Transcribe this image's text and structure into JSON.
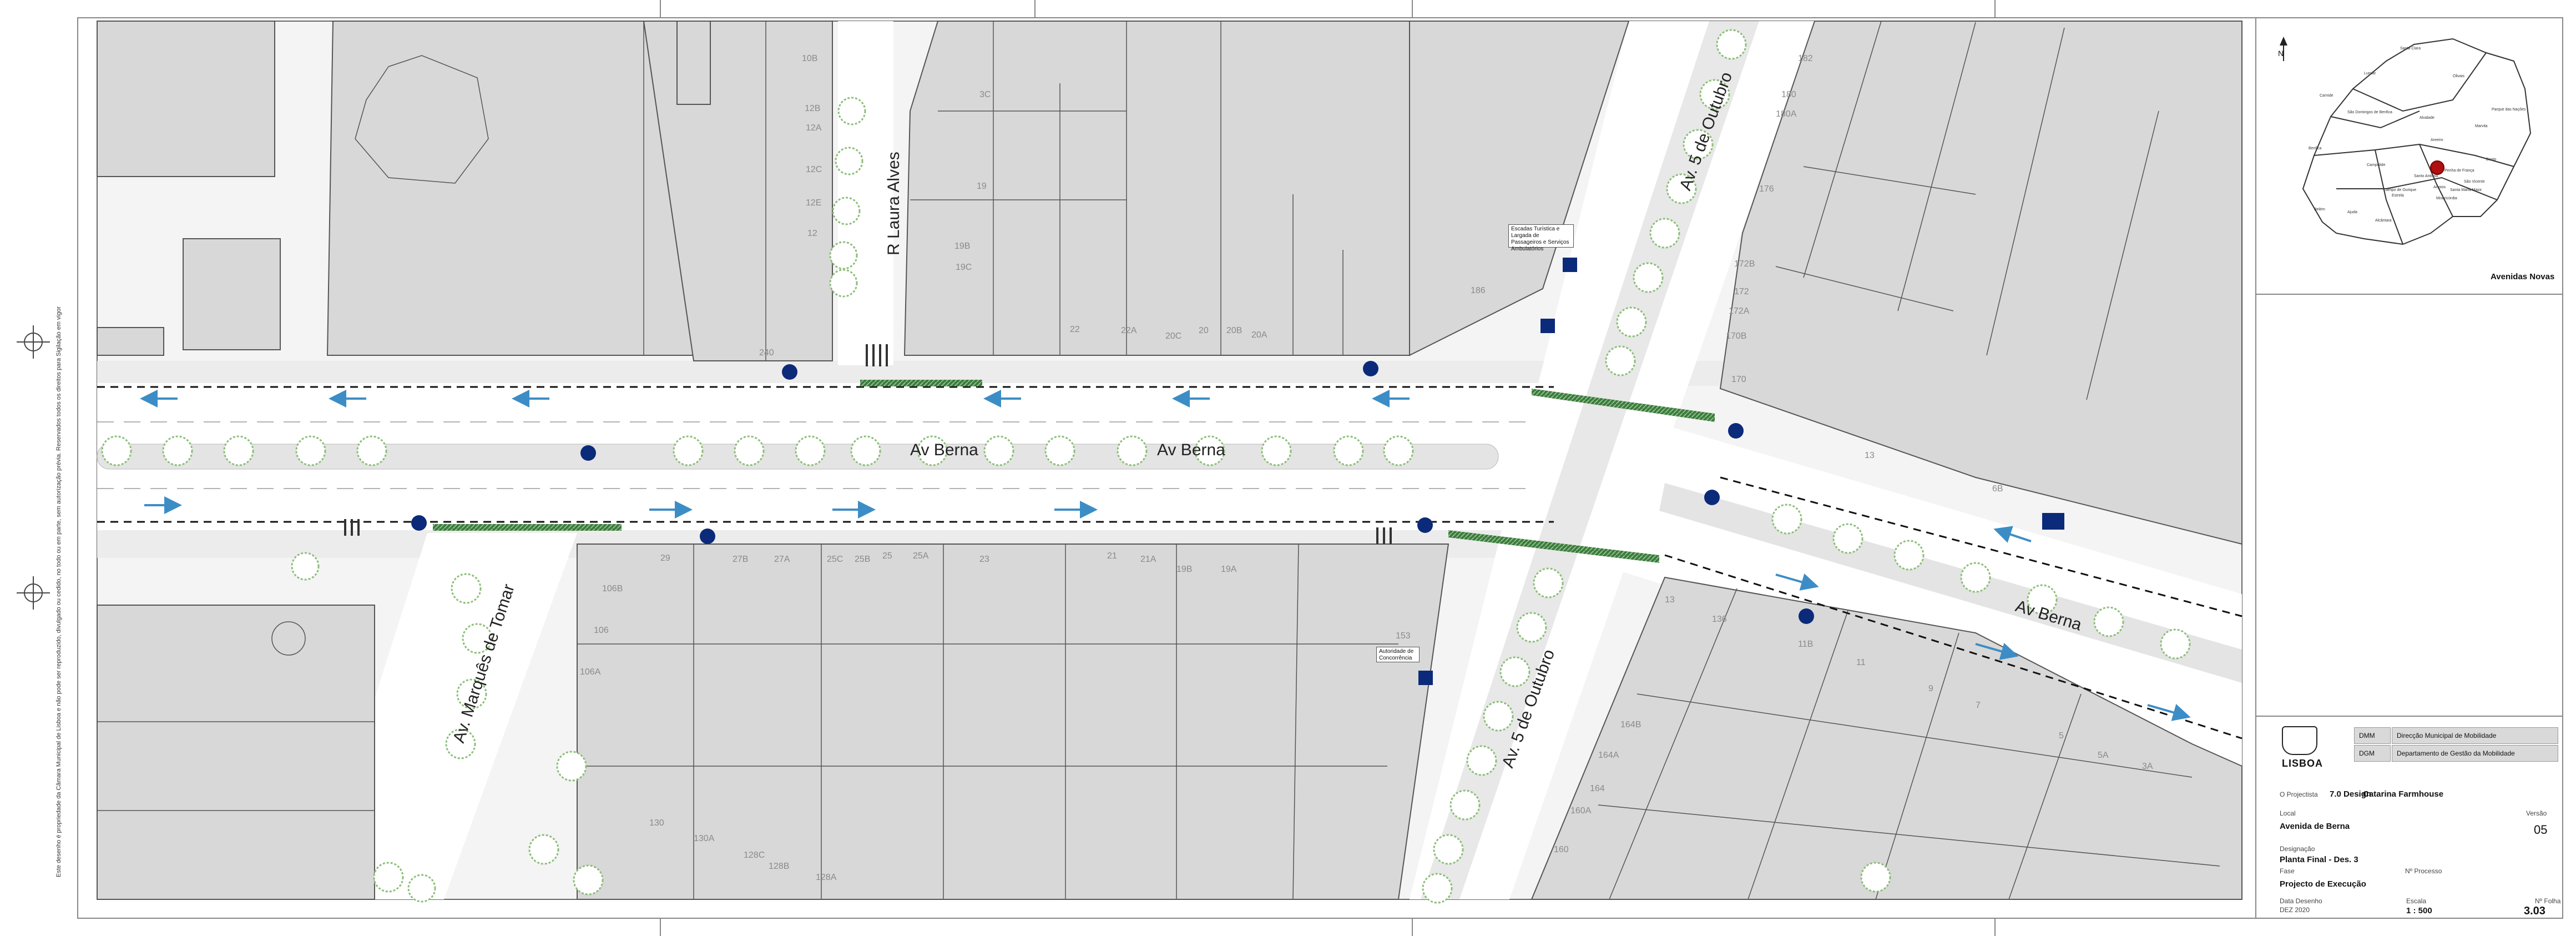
{
  "sheet": {
    "vertical_note": "Este desenho é propriedade da Câmara Municipal de Lisboa e não pode ser reproduzido, divulgado ou cedido, no todo ou em parte, sem autorização prévia. Reservados todos os direitos para Sigilação em vigor"
  },
  "streets": {
    "av_berna_west": "Av Berna",
    "av_berna_center": "Av Berna",
    "av_berna_east": "Av Berna",
    "r_laura_alves": "R Laura Alves",
    "av_5_outubro_north": "Av. 5 de Outubro",
    "av_5_outubro_south": "Av. 5 de Outubro",
    "av_marques_tomar": "Av. Marquês de Tomar"
  },
  "building_numbers": {
    "n1": "10B",
    "n2": "12B",
    "n3": "12A",
    "n4": "12C",
    "n5": "12E",
    "n6": "12",
    "n7": "3C",
    "n8": "19",
    "n9": "19B",
    "n10": "19C",
    "n11": "22",
    "n12": "22A",
    "n13": "20C",
    "n14": "20",
    "n15": "20B",
    "n16": "20A",
    "n17": "182",
    "n18": "180",
    "n19": "180A",
    "n20": "176",
    "n21": "172B",
    "n22": "172",
    "n23": "172A",
    "n24": "170B",
    "n25": "170",
    "n26": "29",
    "n27": "27B",
    "n28": "27A",
    "n29": "25C",
    "n30": "25B",
    "n31": "25",
    "n32": "25A",
    "n33": "23",
    "n34": "21",
    "n35": "21A",
    "n36": "19B",
    "n37": "19A",
    "n38": "106B",
    "n39": "106",
    "n40": "106A",
    "n41": "130",
    "n42": "130A",
    "n43": "128C",
    "n44": "128B",
    "n45": "128A",
    "n46": "136",
    "n47": "13",
    "n48": "11",
    "n49": "11B",
    "n50": "9",
    "n51": "7",
    "n52": "5",
    "n53": "5A",
    "n54": "3A",
    "n55": "164B",
    "n56": "164A",
    "n57": "164",
    "n58": "160",
    "n59": "160A",
    "n60": "240",
    "n61": "186",
    "n62": "6B",
    "n63": "13",
    "n64": "153"
  },
  "annotations": {
    "note_north": "Escadas Turística e Largada de Passageiros e Serviços Ambulatórios",
    "note_south": "Autoridade de Concorrência"
  },
  "locator": {
    "north_label": "N",
    "area_name": "Avenidas Novas",
    "parishes": [
      "Santa Clara",
      "Lumiar",
      "Olivais",
      "Carnide",
      "São Domingos de Benfica",
      "Alvalade",
      "Marvila",
      "Benfica",
      "Areeiro",
      "Beato",
      "Campolide",
      "Penha de França",
      "Santo António",
      "Arroios",
      "Estrela",
      "Belém",
      "Ajuda",
      "Alcântara",
      "Misericórdia",
      "São Vicente",
      "Santa Maria Maior",
      "Campo de Ourique",
      "Parque das Nações"
    ]
  },
  "title_block": {
    "dept_code_1": "DMM",
    "dept_name_1": "Direcção Municipal de Mobilidade",
    "dept_code_2": "DGM",
    "dept_name_2": "Departamento de Gestão da Mobilidade",
    "logo_text": "LISBOA",
    "projetista_label": "O Projectista",
    "projetista_company": "7.0 Design",
    "projetista_name": "Catarina Farmhouse",
    "local_label": "Local",
    "local_value": "Avenida de Berna",
    "version_label": "Versão",
    "version_value": "05",
    "designacao_label": "Designação",
    "designacao_value": "Planta Final - Des. 3",
    "fase_label": "Fase",
    "fase_value": "Projecto de Execução",
    "processo_label": "Nº Processo",
    "data_label": "Data Desenho",
    "data_value": "DEZ 2020",
    "escala_label": "Escala",
    "escala_value": "1 : 500",
    "folha_label": "Nº Folha",
    "folha_value": "3.03"
  },
  "colors": {
    "building": "#d8d8d8",
    "building_stroke": "#555555",
    "sidewalk": "#ececec",
    "road": "#ffffff",
    "green": "#3c7a3c",
    "tree": "#a9cf9a",
    "blue_sign": "#0c2a7a",
    "arrow_blue": "#3c8dc6"
  }
}
